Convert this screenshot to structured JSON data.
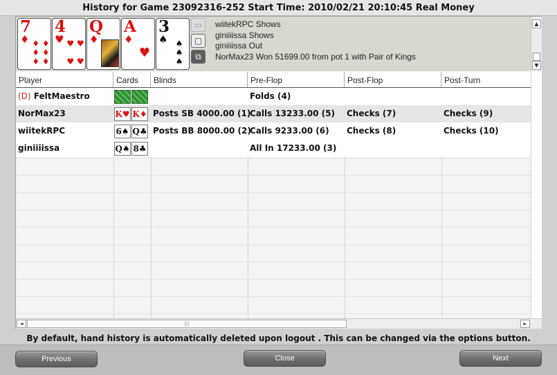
{
  "window": {
    "title": "History for Game 23092316-252 Start Time: 2010/02/21  20:10:45 Real Money"
  },
  "board_cards": [
    {
      "rank": "7",
      "suit": "♦",
      "color": "red",
      "pips": "♦ ♦\n♦ ♦\n♦ ♦"
    },
    {
      "rank": "4",
      "suit": "♥",
      "color": "red",
      "pips": "♥ ♥\n\n♥ ♥"
    },
    {
      "rank": "Q",
      "suit": "♦",
      "color": "red",
      "pips": ""
    },
    {
      "rank": "A",
      "suit": "♦",
      "color": "red",
      "pips": "♥"
    },
    {
      "rank": "3",
      "suit": "♠",
      "color": "black",
      "pips": "♠\n♠\n♠"
    }
  ],
  "side_icons": [
    "cards-icon",
    "chat-icon",
    "window-icon"
  ],
  "log": [
    "wiitekRPC Shows",
    "giniiiissa Shows",
    "giniiiissa Out",
    "NorMax23 Won 51699.00 from pot 1 with Pair of Kings"
  ],
  "table": {
    "columns": [
      "Player",
      "Cards",
      "Blinds",
      "Pre-Flop",
      "Post-Flop",
      "Post-Turn"
    ],
    "rows": [
      {
        "dealer": "(D)",
        "player": "FeltMaestro",
        "cards": [
          {
            "back": true
          },
          {
            "back": true
          }
        ],
        "blinds": "",
        "preflop": "Folds (4)",
        "postflop": "",
        "postturn": ""
      },
      {
        "dealer": "",
        "player": "NorMax23",
        "cards": [
          {
            "rank": "K",
            "suit": "♥",
            "color": "red"
          },
          {
            "rank": "K",
            "suit": "♦",
            "color": "red"
          }
        ],
        "blinds": "Posts SB 4000.00 (1)",
        "preflop": "Calls 13233.00 (5)",
        "postflop": "Checks (7)",
        "postturn": "Checks (9)"
      },
      {
        "dealer": "",
        "player": "wiitekRPC",
        "cards": [
          {
            "rank": "6",
            "suit": "♠",
            "color": "black"
          },
          {
            "rank": "Q",
            "suit": "♣",
            "color": "black"
          }
        ],
        "blinds": "Posts BB 8000.00 (2)",
        "preflop": "Calls 9233.00 (6)",
        "postflop": "Checks (8)",
        "postturn": "Checks (10)"
      },
      {
        "dealer": "",
        "player": "giniiiissa",
        "cards": [
          {
            "rank": "Q",
            "suit": "♠",
            "color": "black"
          },
          {
            "rank": "8",
            "suit": "♣",
            "color": "black"
          }
        ],
        "blinds": "",
        "preflop": "All In 17233.00 (3)",
        "postflop": "",
        "postturn": ""
      }
    ]
  },
  "scroll": {
    "h_thumb_grip": "|||"
  },
  "notice": "By default, hand history is automatically deleted upon logout . This can be changed via the options button.",
  "buttons": {
    "previous": "Previous",
    "close": "Close",
    "next": "Next"
  },
  "colors": {
    "red_suit": "#dd1111",
    "black_suit": "#111111",
    "card_back": "#2d8a2d",
    "button": "#6e6e6e"
  }
}
